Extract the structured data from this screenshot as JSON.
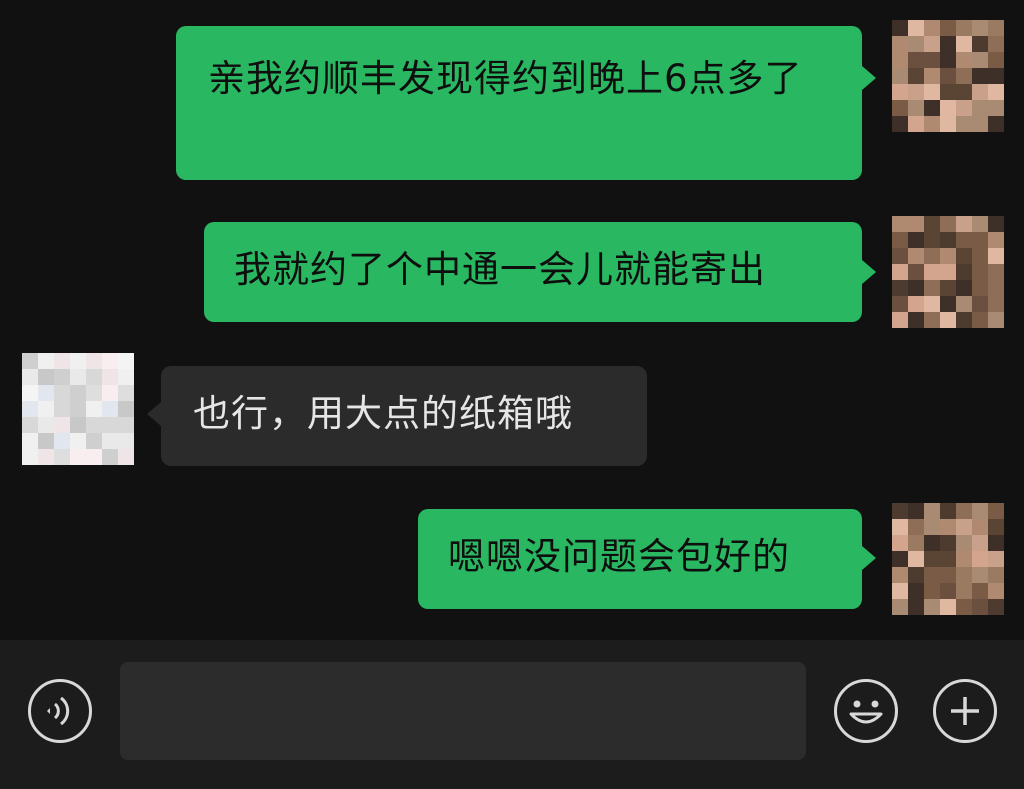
{
  "messages": [
    {
      "side": "out",
      "text": "亲我约顺丰发现得约到晚上6点多了"
    },
    {
      "side": "out",
      "text": "我就约了个中通一会儿就能寄出"
    },
    {
      "side": "in",
      "text": "也行，用大点的纸箱哦"
    },
    {
      "side": "out",
      "text": "嗯嗯没问题会包好的"
    }
  ],
  "input_bar": {
    "voice_icon": "voice-icon",
    "emoji_icon": "emoji-icon",
    "more_icon": "plus-icon",
    "input_value": ""
  },
  "colors": {
    "background": "#111111",
    "outgoing_bubble": "#29b861",
    "incoming_bubble": "#2b2b2b",
    "input_bar": "#1c1c1c"
  }
}
